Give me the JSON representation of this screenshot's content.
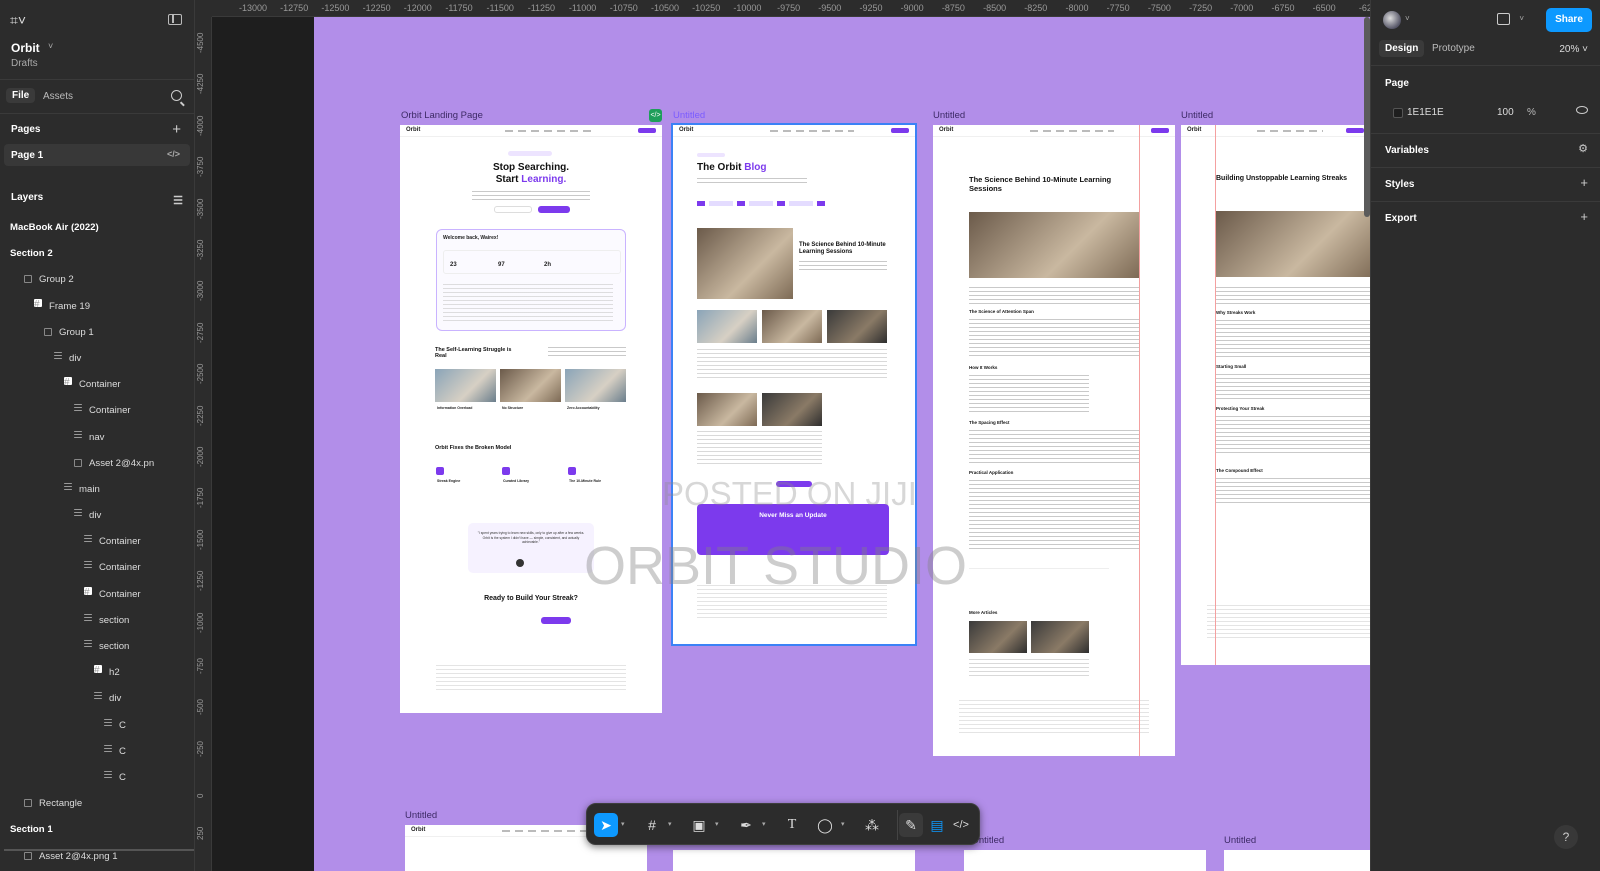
{
  "left_panel": {
    "project_name": "Orbit",
    "project_sub": "Drafts",
    "tabs": [
      "File",
      "Assets"
    ],
    "pages_header": "Pages",
    "pages": [
      "Page 1"
    ],
    "layers_header": "Layers",
    "layers": [
      {
        "label": "MacBook Air (2022)",
        "bold": true,
        "indent": 0,
        "icon": "none"
      },
      {
        "label": "Section 2",
        "bold": true,
        "indent": 0,
        "icon": "none"
      },
      {
        "label": "Group 2",
        "bold": false,
        "indent": 1,
        "icon": "group"
      },
      {
        "label": "Frame 19",
        "bold": false,
        "indent": 2,
        "icon": "frame"
      },
      {
        "label": "Group 1",
        "bold": false,
        "indent": 3,
        "icon": "group"
      },
      {
        "label": "div",
        "bold": false,
        "indent": 4,
        "icon": "autolayout"
      },
      {
        "label": "Container",
        "bold": false,
        "indent": 5,
        "icon": "frame"
      },
      {
        "label": "Container",
        "bold": false,
        "indent": 6,
        "icon": "text"
      },
      {
        "label": "nav",
        "bold": false,
        "indent": 6,
        "icon": "text"
      },
      {
        "label": "Asset 2@4x.pn",
        "bold": false,
        "indent": 6,
        "icon": "image"
      },
      {
        "label": "main",
        "bold": false,
        "indent": 5,
        "icon": "text"
      },
      {
        "label": "div",
        "bold": false,
        "indent": 6,
        "icon": "text"
      },
      {
        "label": "Container",
        "bold": false,
        "indent": 7,
        "icon": "text"
      },
      {
        "label": "Container",
        "bold": false,
        "indent": 7,
        "icon": "text"
      },
      {
        "label": "Container",
        "bold": false,
        "indent": 7,
        "icon": "frame"
      },
      {
        "label": "section",
        "bold": false,
        "indent": 7,
        "icon": "text"
      },
      {
        "label": "section",
        "bold": false,
        "indent": 7,
        "icon": "text"
      },
      {
        "label": "h2",
        "bold": false,
        "indent": 8,
        "icon": "frame"
      },
      {
        "label": "div",
        "bold": false,
        "indent": 8,
        "icon": "text"
      },
      {
        "label": "C",
        "bold": false,
        "indent": 9,
        "icon": "text"
      },
      {
        "label": "C",
        "bold": false,
        "indent": 9,
        "icon": "text"
      },
      {
        "label": "C",
        "bold": false,
        "indent": 9,
        "icon": "text"
      },
      {
        "label": "Rectangle",
        "bold": false,
        "indent": 1,
        "icon": "image"
      },
      {
        "label": "Section 1",
        "bold": true,
        "indent": 0,
        "icon": "none"
      },
      {
        "label": "Asset 2@4x.png 1",
        "bold": false,
        "indent": 1,
        "icon": "image"
      }
    ]
  },
  "ruler": {
    "top": [
      "-13000",
      "-12750",
      "-12500",
      "-12250",
      "-12000",
      "-11750",
      "-11500",
      "-11250",
      "-11000",
      "-10750",
      "-10500",
      "-10250",
      "-10000",
      "-9750",
      "-9500",
      "-9250",
      "-9000",
      "-8750",
      "-8500",
      "-8250",
      "-8000",
      "-7750",
      "-7500",
      "-7250",
      "-7000",
      "-6750",
      "-6500",
      "-62"
    ],
    "left": [
      "-4500",
      "-4250",
      "-4000",
      "-3750",
      "-3500",
      "-3250",
      "-3000",
      "-2750",
      "-2500",
      "-2250",
      "-2000",
      "-1750",
      "-1500",
      "-1250",
      "-1000",
      "-750",
      "-500",
      "-250",
      "0",
      "250"
    ]
  },
  "canvas": {
    "frame_labels": [
      "Orbit Landing Page",
      "Untitled",
      "Untitled",
      "Untitled",
      "Untitled",
      "Untitled",
      "Untitled"
    ],
    "landing": {
      "headline_1": "Stop Searching.",
      "headline_2": "Start",
      "headline_accent": "Learning.",
      "welcome": "Welcome back, Wairex!",
      "stats": [
        "23",
        "97",
        "2h"
      ],
      "struggle_title": "The Self-Learning Struggle is Real",
      "card_labels": [
        "Information Overload",
        "No Structure",
        "Zero Accountability"
      ],
      "fixes_title": "Orbit Fixes the Broken Model",
      "fix_labels": [
        "Streak Engine",
        "Curated Library",
        "The 10-Minute Rule"
      ],
      "quote": "\"I spent years trying to learn new skills, only to give up after a few weeks. Orbit is the system I didn't have — simple, consistent, and actually achievable.\"",
      "cta_title": "Ready to Build Your Streak?",
      "nav_logo": "Orbit"
    },
    "blog": {
      "title": "The Orbit",
      "title_accent": "Blog",
      "featured_title": "The Science Behind 10-Minute Learning Sessions",
      "news_title": "Never Miss an Update",
      "nav_logo": "Orbit"
    },
    "article1": {
      "title": "The Science Behind 10-Minute Learning Sessions",
      "h_attention": "The Science of Attention Span",
      "h_how": "How It Works",
      "h_spacing": "The Spacing Effect",
      "h_practical": "Practical Application",
      "more": "More Articles",
      "nav_logo": "Orbit"
    },
    "article2": {
      "title": "Building Unstoppable Learning Streaks",
      "h_why": "Why Streaks Work",
      "h_small": "Starting Small",
      "h_protect": "Protecting Your Streak",
      "h_compound": "The Compound Effect",
      "nav_logo": "Orbit"
    },
    "watermark_1": "POSTED ON JIJI",
    "watermark_2": "ORBIT STUDIO"
  },
  "toolbar": {
    "tools": [
      "move-tool",
      "frame-tool",
      "image-tool",
      "pen-tool",
      "text-tool",
      "comment-tool",
      "actions-tool",
      "draw-toggle",
      "design-toggle",
      "dev-toggle"
    ]
  },
  "right_panel": {
    "share_label": "Share",
    "tabs": [
      "Design",
      "Prototype"
    ],
    "zoom": "20%",
    "page_header": "Page",
    "bg_hex": "1E1E1E",
    "bg_opacity": "100",
    "bg_opacity_unit": "%",
    "variables": "Variables",
    "styles": "Styles",
    "export": "Export",
    "help": "?"
  },
  "colors": {
    "canvas_bg": "#b28ee9",
    "accent": "#7c3aed",
    "share": "#0d99ff"
  }
}
